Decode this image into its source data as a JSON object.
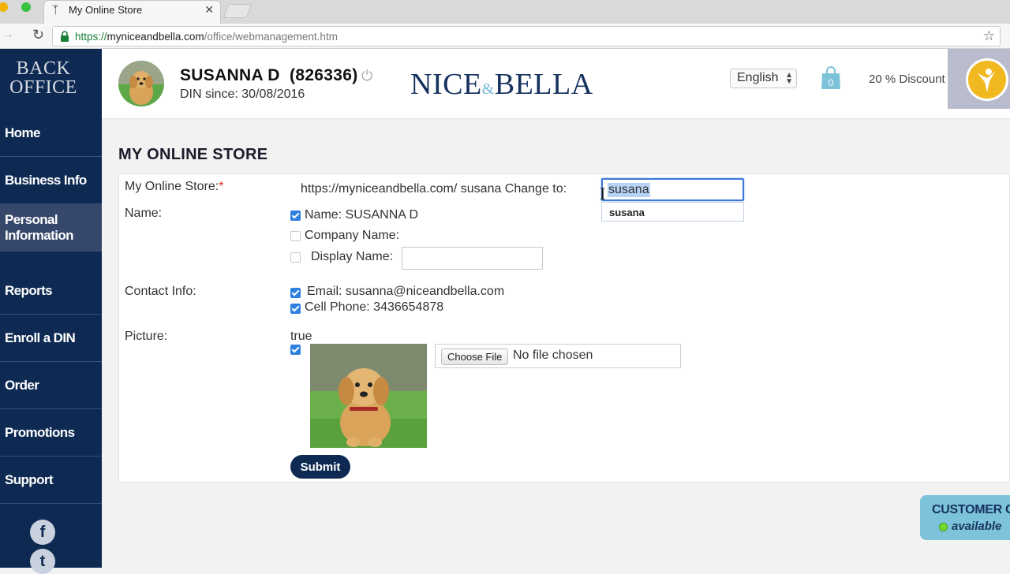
{
  "browser": {
    "tab_title": "My Online Store",
    "url_protocol": "https://",
    "url_host": "myniceandbella.com",
    "url_path": "/office/webmanagement.htm"
  },
  "sidebar": {
    "logo_line1": "BACK",
    "logo_line2": "OFFICE",
    "items": [
      {
        "label": "Home",
        "active": false
      },
      {
        "label": "Business Info",
        "active": false
      },
      {
        "label": "Personal Information",
        "active": true
      },
      {
        "label": "Reports",
        "active": false
      },
      {
        "label": "Enroll a DIN",
        "active": false
      },
      {
        "label": "Order",
        "active": false
      },
      {
        "label": "Promotions",
        "active": false
      },
      {
        "label": "Support",
        "active": false
      }
    ],
    "social_icons": [
      "facebook-icon",
      "twitter-icon"
    ]
  },
  "header": {
    "user_name": "SUSANNA D",
    "user_id": "(826336)",
    "din_since": "DIN since: 30/08/2016",
    "brand_left": "NICE",
    "brand_amp": "&",
    "brand_right": "BELLA",
    "language": "English",
    "cart_count": "0",
    "discount": "20 % Discount"
  },
  "page": {
    "title": "MY ONLINE STORE"
  },
  "form": {
    "store_label": "My Online Store:",
    "store_required": "*",
    "store_url_text": "https://myniceandbella.com/ susana Change to:",
    "store_input_value": "susana",
    "autocomplete_option": "susana",
    "name_label": "Name:",
    "name_option": "Name: SUSANNA D",
    "company_option": "Company Name:",
    "display_name_option": "Display Name:",
    "display_name_value": "",
    "contact_label": "Contact Info:",
    "email_option": "Email: susanna@niceandbella.com",
    "phone_option": "Cell Phone: 3436654878",
    "picture_label": "Picture:",
    "picture_flag": "true",
    "choose_file": "Choose File",
    "no_file": "No file chosen",
    "submit": "Submit",
    "checkboxes": {
      "name": true,
      "company": false,
      "display_name": false,
      "email": true,
      "phone": true,
      "picture": true
    }
  },
  "customer_care": {
    "line1": "CUSTOMER CARE",
    "line2": "available"
  },
  "colors": {
    "sidebar": "#0e2a52",
    "accent": "#2f7fe0",
    "brand": "#16325e",
    "care_badge": "#7cc2d9"
  }
}
